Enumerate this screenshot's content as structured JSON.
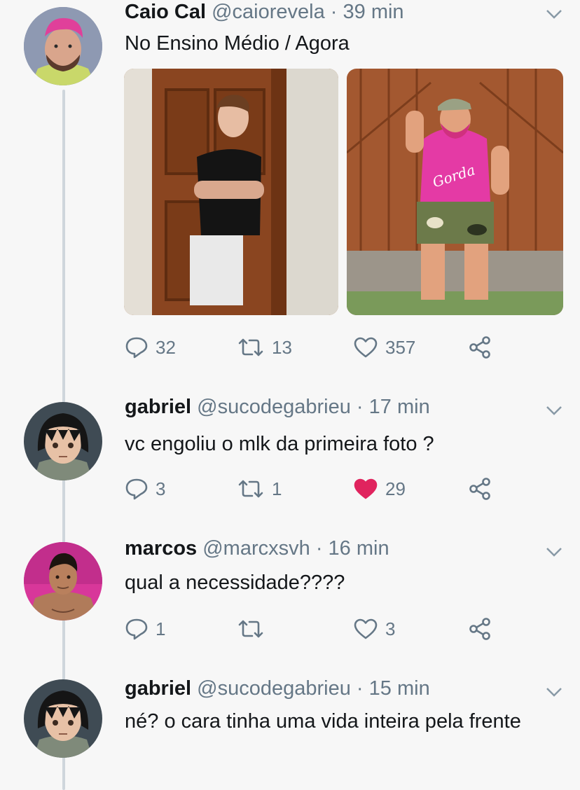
{
  "tweets": [
    {
      "name": "Caio Cal",
      "handle": "@caiorevela",
      "separator": "·",
      "time": "39 min",
      "text": "No Ensino Médio / Agora",
      "media": {
        "left_photo_icon": "photo-before",
        "right_photo_icon": "photo-after",
        "shirt_text": "Gorda"
      },
      "replies": "32",
      "retweets": "13",
      "likes": "357",
      "liked": false
    },
    {
      "name": "gabriel",
      "handle": "@sucodegabrieu",
      "separator": "·",
      "time": "17 min",
      "text": "vc engoliu o mlk da primeira foto ?",
      "replies": "3",
      "retweets": "1",
      "likes": "29",
      "liked": true,
      "like_color": "#e0245e"
    },
    {
      "name": "marcos",
      "handle": "@marcxsvh",
      "separator": "·",
      "time": "16 min",
      "text": "qual a necessidade????",
      "replies": "1",
      "retweets": "",
      "likes": "3",
      "liked": false
    },
    {
      "name": "gabriel",
      "handle": "@sucodegabrieu",
      "separator": "·",
      "time": "15 min",
      "text": "né? o cara tinha uma vida inteira pela frente"
    }
  ],
  "icons": {
    "reply": "reply-icon",
    "retweet": "retweet-icon",
    "like": "heart-icon",
    "share": "share-icon",
    "caret": "chevron-down-icon"
  },
  "colors": {
    "background": "#f7f7f7",
    "text": "#14171a",
    "secondary": "#657786",
    "like_active": "#e0245e",
    "thread_line": "#cfd6dc"
  }
}
